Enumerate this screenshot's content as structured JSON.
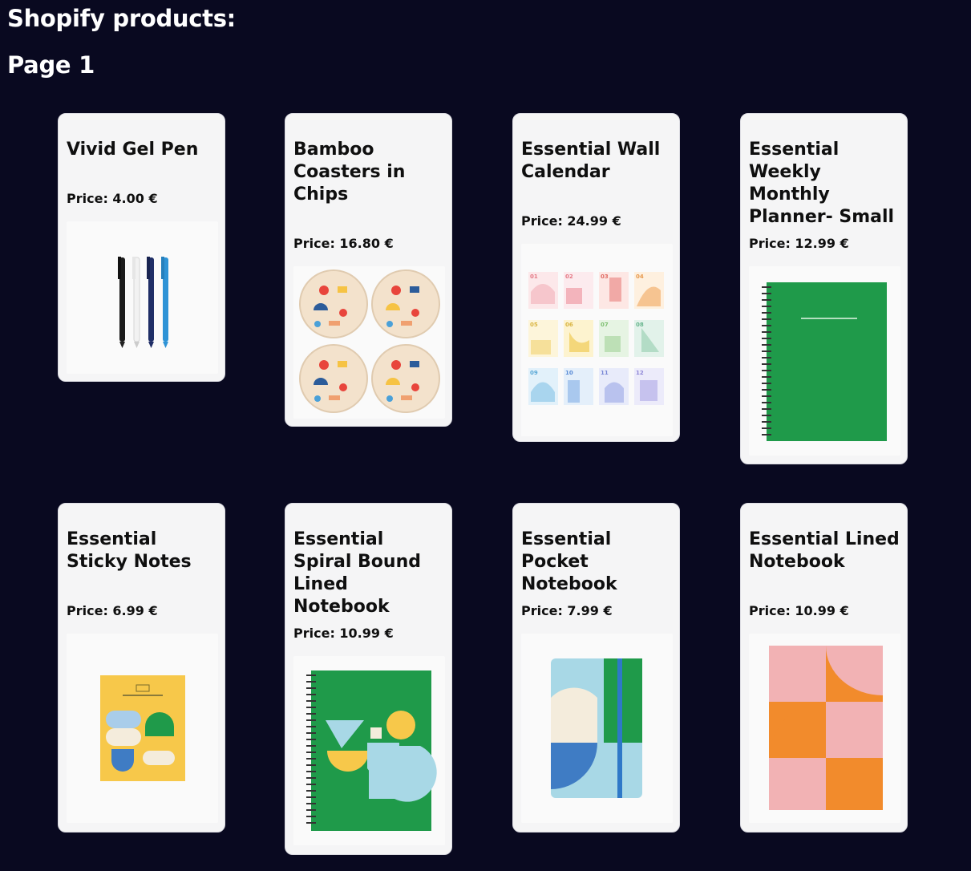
{
  "heading": "Shopify products:",
  "page_label": "Page 1",
  "products": [
    {
      "title": "Vivid Gel Pen",
      "price": "Price: 4.00 €",
      "image_icon": "gel-pens-image"
    },
    {
      "title": "Bamboo Coasters in Chips",
      "price": "Price: 16.80 €",
      "image_icon": "coasters-image"
    },
    {
      "title": "Essential Wall Calendar",
      "price": "Price: 24.99 €",
      "image_icon": "calendar-image"
    },
    {
      "title": "Essential Weekly Monthly Planner- Small",
      "price": "Price: 12.99 €",
      "image_icon": "planner-image"
    },
    {
      "title": "Essential Sticky Notes",
      "price": "Price: 6.99 €",
      "image_icon": "sticky-notes-image"
    },
    {
      "title": "Essential Spiral Bound Lined Notebook",
      "price": "Price: 10.99 €",
      "image_icon": "spiral-notebook-image"
    },
    {
      "title": "Essential Pocket Notebook",
      "price": "Price: 7.99 €",
      "image_icon": "pocket-notebook-image"
    },
    {
      "title": "Essential Lined Notebook",
      "price": "Price: 10.99 €",
      "image_icon": "lined-notebook-image"
    }
  ],
  "calendar_months": [
    "01",
    "02",
    "03",
    "04",
    "05",
    "06",
    "07",
    "08",
    "09",
    "10",
    "11",
    "12"
  ],
  "colors": {
    "background": "#090920",
    "card": "#f5f5f6",
    "green": "#1f9a4a",
    "orange": "#f28b2c",
    "pink": "#f2b2b4",
    "yellow": "#f7c84a",
    "light_blue": "#a8d8e6",
    "blue": "#3f7cc4"
  }
}
